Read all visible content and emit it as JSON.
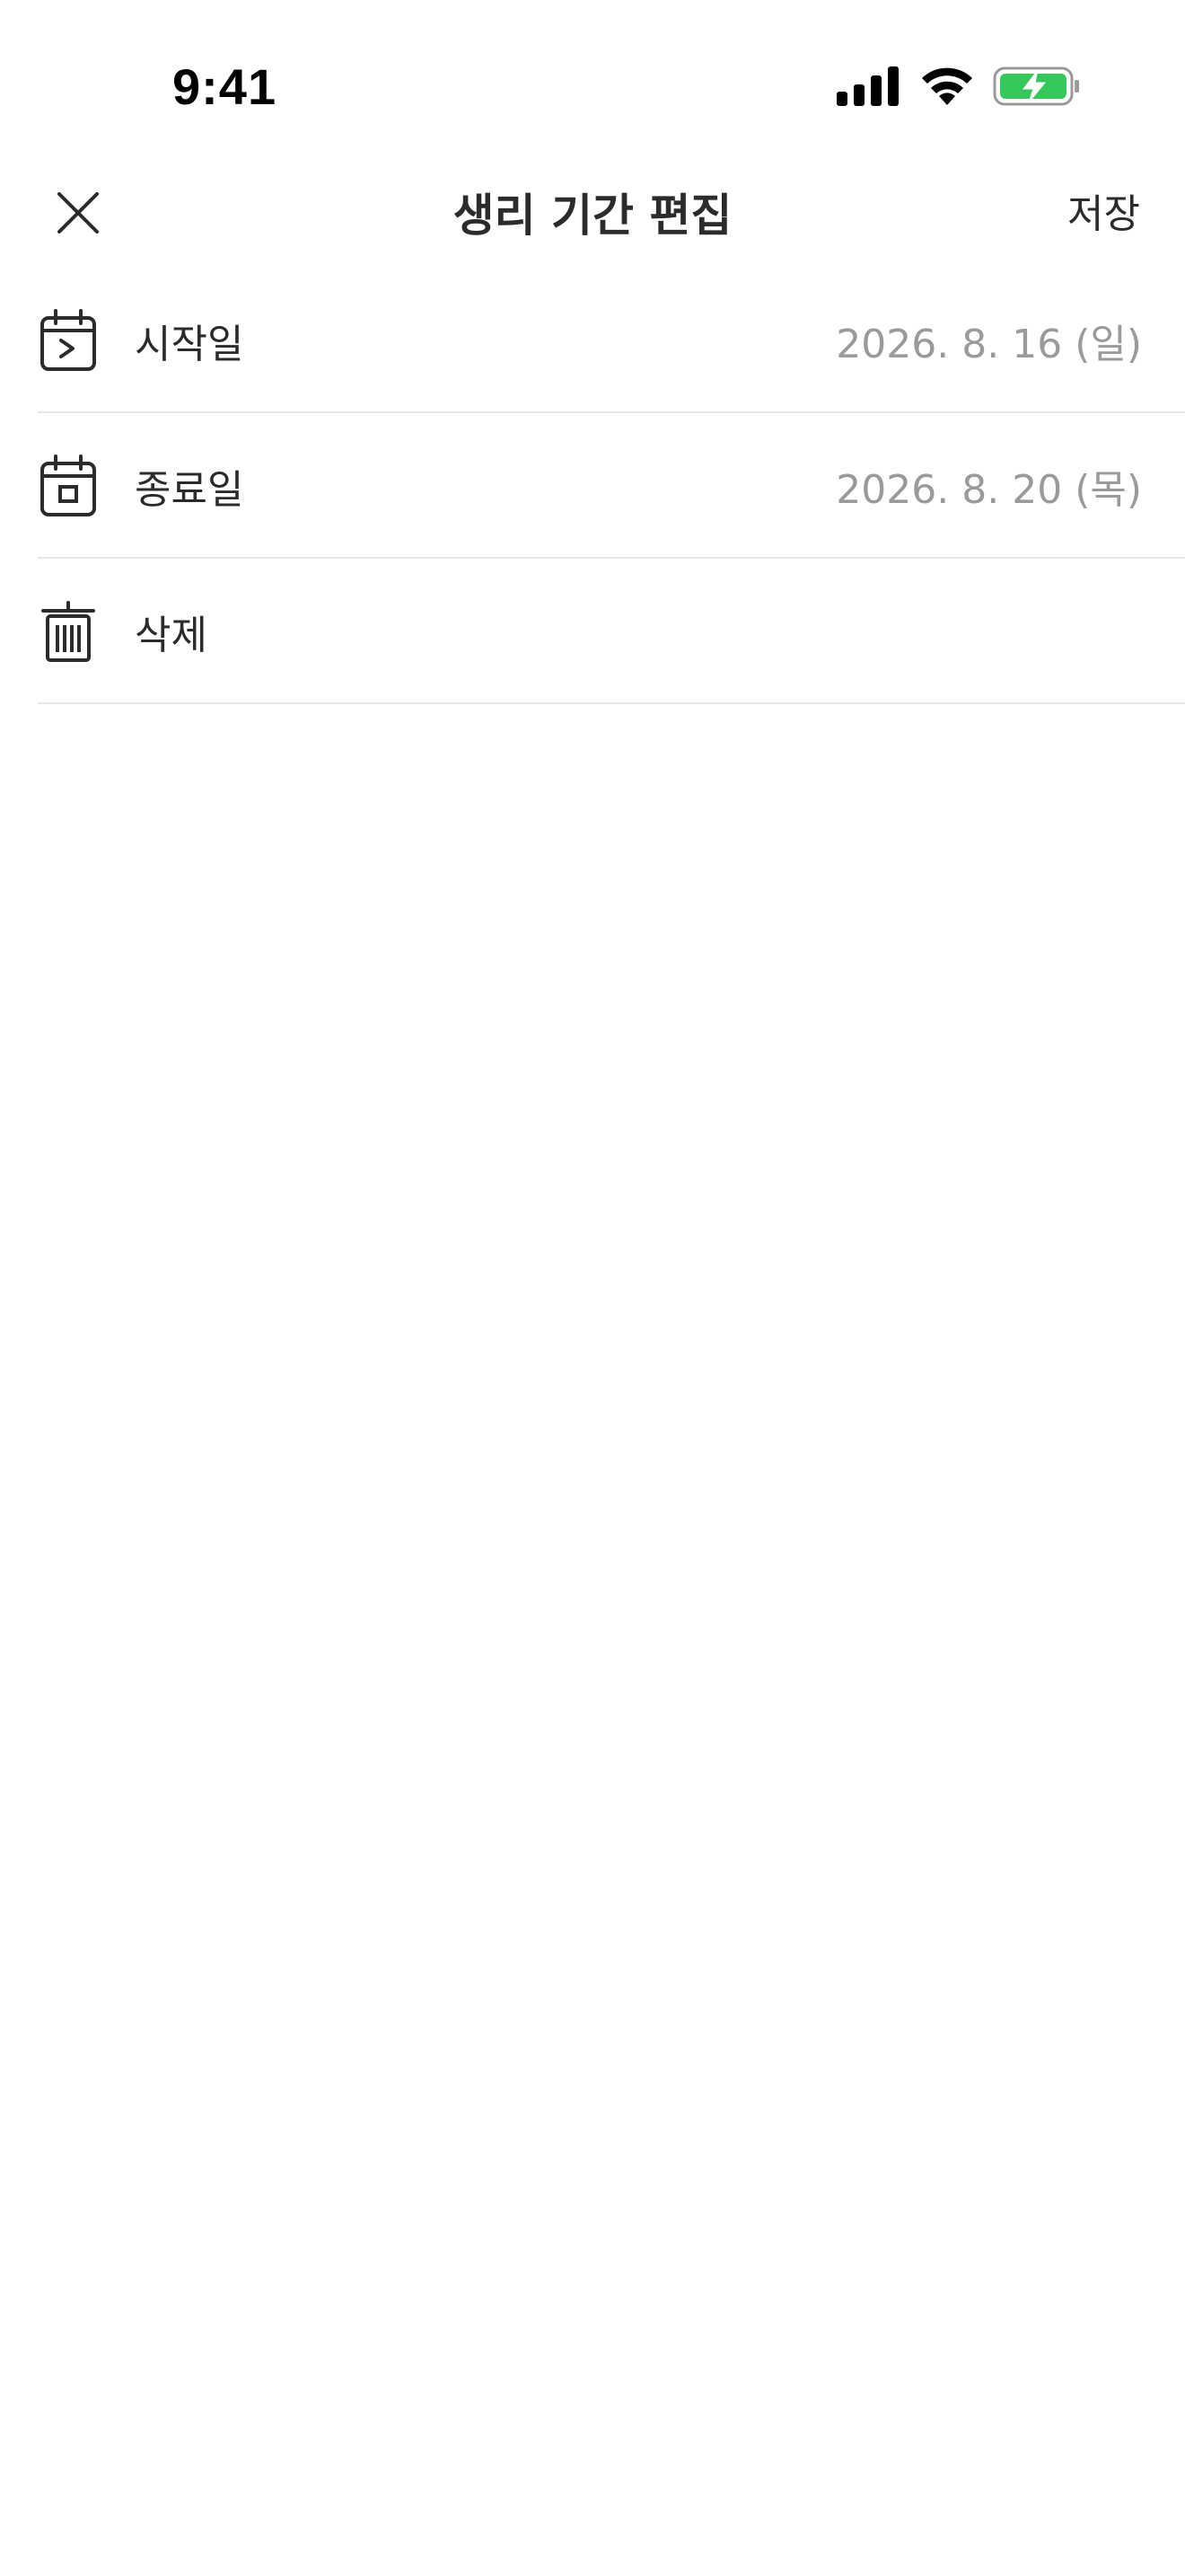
{
  "status_bar": {
    "time": "9:41"
  },
  "nav": {
    "title": "생리 기간 편집",
    "save_label": "저장"
  },
  "rows": [
    {
      "label": "시작일",
      "value": "2026. 8. 16 (일)",
      "icon": "calendar-start-icon"
    },
    {
      "label": "종료일",
      "value": "2026. 8. 20 (목)",
      "icon": "calendar-end-icon"
    },
    {
      "label": "삭제",
      "value": "",
      "icon": "trash-icon"
    }
  ],
  "colors": {
    "battery_fill": "#34c759",
    "separator": "#e6e6e6",
    "secondary_text": "#9a9a9a"
  }
}
